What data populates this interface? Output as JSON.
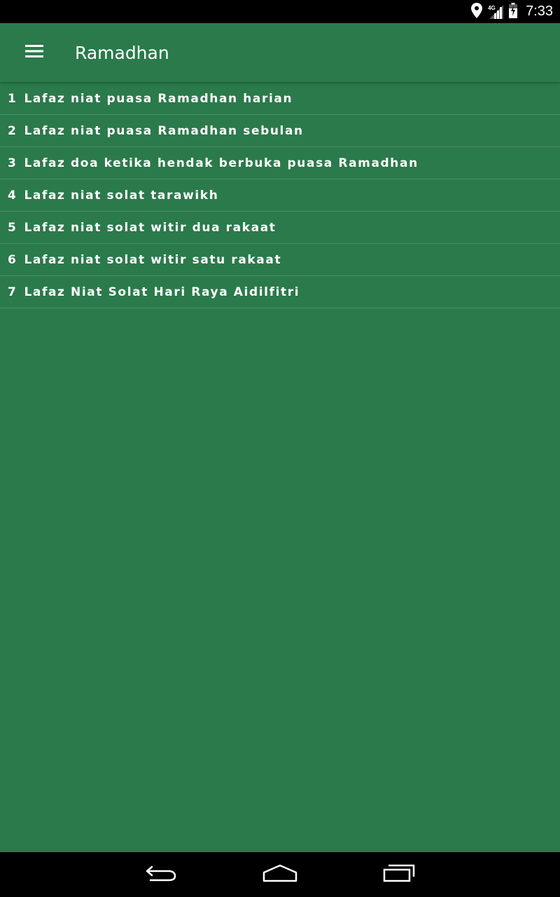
{
  "status_bar": {
    "time": "7:33",
    "network": "4G",
    "icons": [
      "location-icon",
      "signal-icon",
      "battery-icon"
    ]
  },
  "app_bar": {
    "title": "Ramadhan",
    "menu_icon": "hamburger-menu-icon"
  },
  "list": {
    "items": [
      {
        "number": "1",
        "label": "Lafaz niat puasa Ramadhan harian"
      },
      {
        "number": "2",
        "label": "Lafaz niat puasa Ramadhan sebulan"
      },
      {
        "number": "3",
        "label": "Lafaz doa ketika hendak berbuka puasa Ramadhan"
      },
      {
        "number": "4",
        "label": "Lafaz niat solat tarawikh"
      },
      {
        "number": "5",
        "label": "Lafaz niat solat witir dua rakaat"
      },
      {
        "number": "6",
        "label": "Lafaz niat solat witir satu rakaat"
      },
      {
        "number": "7",
        "label": "Lafaz Niat Solat Hari Raya Aidilfitri"
      }
    ]
  },
  "nav_bar": {
    "icons": [
      "back-icon",
      "home-icon",
      "recents-icon"
    ]
  },
  "colors": {
    "primary": "#2b7a4b",
    "text": "#ffffff",
    "system_bar": "#000000"
  }
}
